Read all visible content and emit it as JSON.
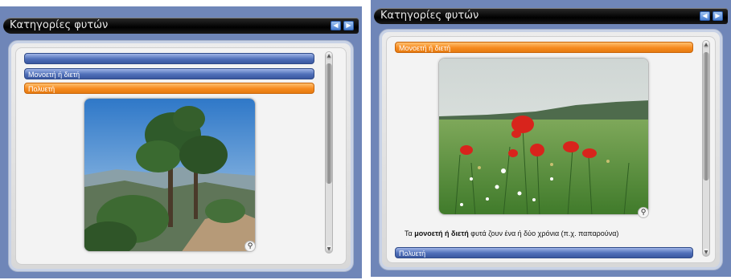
{
  "left_panel": {
    "title": "Κατηγορίες φυτών",
    "accordion": [
      {
        "label": "",
        "state": "collapsed"
      },
      {
        "label": "Μονοετή ή διετή",
        "state": "collapsed"
      },
      {
        "label": "Πολυετή",
        "state": "active"
      }
    ]
  },
  "right_panel": {
    "title": "Κατηγορίες φυτών",
    "accordion": [
      {
        "label": "Μονοετή ή διετή",
        "state": "active"
      },
      {
        "label": "Πολυετή",
        "state": "collapsed"
      }
    ],
    "caption": {
      "prefix": "Τα ",
      "bold": "μονοετή ή διετή",
      "suffix": " φυτά ζουν ένα ή δύο χρόνια (π.χ. παπαρούνα)"
    }
  },
  "icons": {
    "prev": "arrow-left-icon",
    "next": "arrow-right-icon",
    "zoom": "magnifier-icon",
    "scroll_up": "chevron-up-icon",
    "scroll_down": "chevron-down-icon"
  },
  "colors": {
    "accent_blue": "#4f6fb8",
    "accent_orange": "#f68a1e",
    "panel_bg": "#6f86b8",
    "titlebar": "#000000"
  }
}
